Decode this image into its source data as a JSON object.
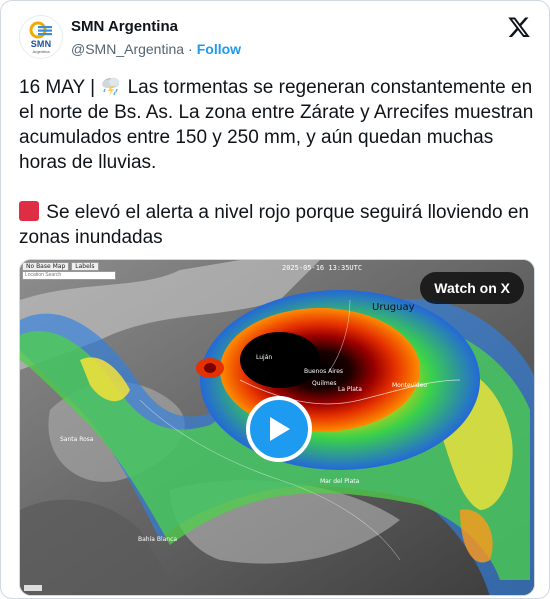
{
  "author": {
    "display_name": "SMN Argentina",
    "handle": "@SMN_Argentina",
    "separator": "·",
    "follow_label": "Follow",
    "avatar_text": "SMN",
    "avatar_subtext": "Argentina"
  },
  "tweet": {
    "paragraph1_prefix": "16 MAY | ",
    "paragraph1_body": " Las tormentas se regeneran constantemente en el norte de Bs. As. La zona entre Zárate y Arrecifes muestran acumulados entre 150 y 250 mm, y aún quedan muchas horas de lluvias.",
    "paragraph2_body": " Se elevó el alerta a nivel rojo porque seguirá lloviendo en zonas inundadas"
  },
  "media": {
    "watch_label": "Watch on X",
    "timestamp": "2025-05-16 13:35UTC",
    "map_buttons": [
      "No Base Map",
      "Labels"
    ],
    "search_placeholder": "Location Search",
    "labels": {
      "uruguay": "Uruguay",
      "buenos_aires": "Buenos Aires",
      "la_plata": "La Plata",
      "montevideo": "Montevideo",
      "quilmes": "Quilmes",
      "mar_del_plata": "Mar del Plata",
      "bahia_blanca": "Bahía Blanca",
      "lujan": "Luján",
      "santa_rosa": "Santa Rosa"
    }
  },
  "colors": {
    "follow": "#1d9bf0",
    "play_button": "#1d9bf0",
    "alert_red": "#dd2e44",
    "muted_text": "#536471"
  },
  "icons": {
    "storm": "cloud-with-lightning-and-rain-icon",
    "alert": "red-square-icon",
    "brand": "x-logo-icon",
    "play": "play-icon"
  }
}
